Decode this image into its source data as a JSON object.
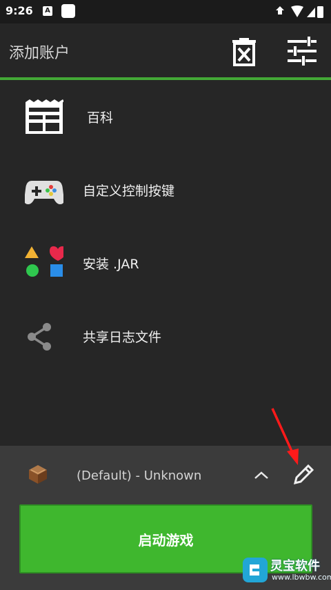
{
  "status_bar": {
    "time": "9:26",
    "a_icon": "A"
  },
  "app_bar": {
    "title": "添加账户",
    "delete_icon": "delete-account-icon",
    "settings_icon": "sliders-icon"
  },
  "menu": {
    "items": [
      {
        "label": "百科",
        "icon": "wiki-icon"
      },
      {
        "label": "自定义控制按键",
        "icon": "gamepad-icon"
      },
      {
        "label": "安装 .JAR",
        "icon": "shapes-icon"
      },
      {
        "label": "共享日志文件",
        "icon": "share-icon"
      }
    ]
  },
  "profile": {
    "name": "(Default) - Unknown"
  },
  "launch": {
    "label": "启动游戏"
  },
  "watermark": {
    "name": "灵宝软件",
    "site": "www.lbwbw.com"
  },
  "colors": {
    "accent": "#43a936",
    "launch": "#3fb72e",
    "arrow": "#ff1a1a"
  }
}
